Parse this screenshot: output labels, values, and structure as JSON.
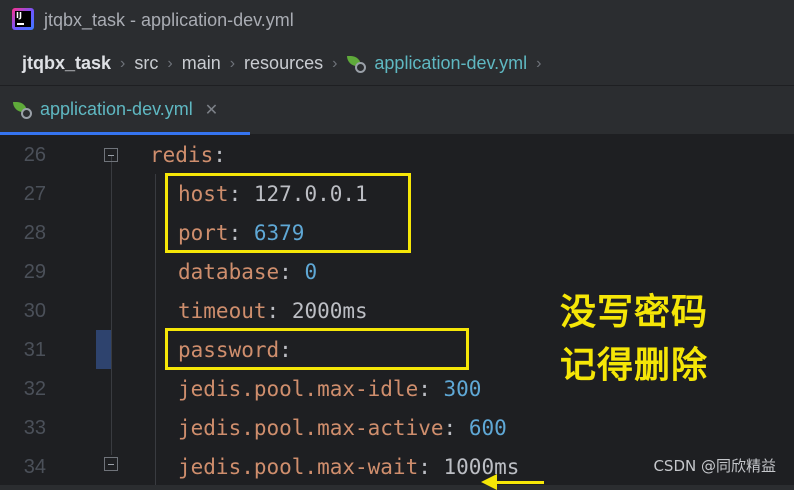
{
  "window": {
    "title": "jtqbx_task - application-dev.yml",
    "logo_text": "IJ"
  },
  "breadcrumb": {
    "items": [
      {
        "label": "jtqbx_task"
      },
      {
        "label": "src"
      },
      {
        "label": "main"
      },
      {
        "label": "resources"
      },
      {
        "label": "application-dev.yml",
        "icon": "spring-yaml-icon"
      }
    ],
    "separator": "›"
  },
  "tabs": [
    {
      "label": "application-dev.yml",
      "icon": "spring-yaml-icon",
      "close_glyph": "✕",
      "active": true
    }
  ],
  "editor": {
    "lines": [
      {
        "num": "26",
        "tokens": [
          {
            "t": "redis",
            "c": "k"
          },
          {
            "t": ":",
            "c": "p"
          }
        ]
      },
      {
        "num": "27",
        "tokens": [
          {
            "t": "host",
            "c": "k"
          },
          {
            "t": ": ",
            "c": "p"
          },
          {
            "t": "127.0.0.1",
            "c": "v"
          }
        ]
      },
      {
        "num": "28",
        "tokens": [
          {
            "t": "port",
            "c": "k"
          },
          {
            "t": ": ",
            "c": "p"
          },
          {
            "t": "6379",
            "c": "n"
          }
        ]
      },
      {
        "num": "29",
        "tokens": [
          {
            "t": "database",
            "c": "k"
          },
          {
            "t": ": ",
            "c": "p"
          },
          {
            "t": "0",
            "c": "n"
          }
        ]
      },
      {
        "num": "30",
        "tokens": [
          {
            "t": "timeout",
            "c": "k"
          },
          {
            "t": ": ",
            "c": "p"
          },
          {
            "t": "2000ms",
            "c": "v"
          }
        ]
      },
      {
        "num": "31",
        "tokens": [
          {
            "t": "password",
            "c": "k"
          },
          {
            "t": ":",
            "c": "p"
          }
        ]
      },
      {
        "num": "32",
        "tokens": [
          {
            "t": "jedis.pool.max-idle",
            "c": "k"
          },
          {
            "t": ": ",
            "c": "p"
          },
          {
            "t": "300",
            "c": "n"
          }
        ]
      },
      {
        "num": "33",
        "tokens": [
          {
            "t": "jedis.pool.max-active",
            "c": "k"
          },
          {
            "t": ": ",
            "c": "p"
          },
          {
            "t": "600",
            "c": "n"
          }
        ]
      },
      {
        "num": "34",
        "tokens": [
          {
            "t": "jedis.pool.max-wait",
            "c": "k"
          },
          {
            "t": ": ",
            "c": "p"
          },
          {
            "t": "1000ms",
            "c": "v"
          }
        ]
      }
    ]
  },
  "annotation": {
    "line1": "没写密码",
    "line2": "记得删除",
    "color": "#f5e607"
  },
  "watermark": "CSDN @同欣精益",
  "colors": {
    "keyword": "#cf8e6d",
    "number": "#5fa8d6",
    "text": "#bcbec4",
    "file_name": "#5fb8c2",
    "editor_bg": "#1e1f22",
    "chrome_bg": "#2b2d30"
  }
}
